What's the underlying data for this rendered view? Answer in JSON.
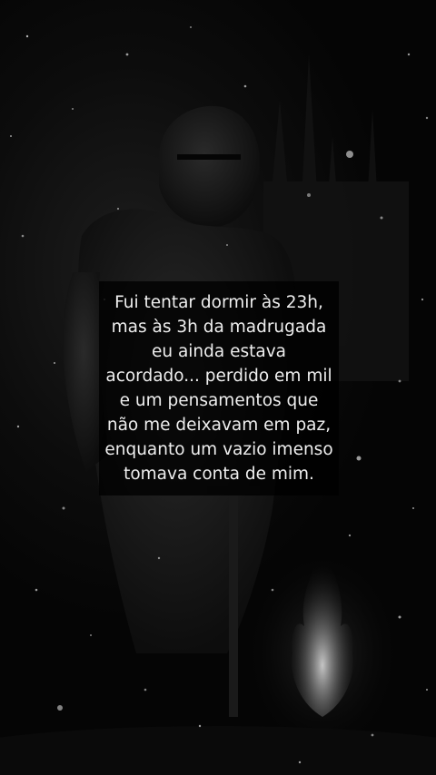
{
  "background": {
    "scene": "dark-knight-in-snow",
    "colors": {
      "base": "#060606",
      "figure": "#1e1e1e",
      "fire": "#cfcfcf",
      "snow": "#ffffff"
    }
  },
  "caption": {
    "text": "Fui tentar dormir às 23h,\nmas às 3h da madrugada\neu ainda estava\nacordado... perdido em mil\ne um pensamentos que\nnão me deixavam em paz,\nenquanto um vazio imenso\ntomava conta de mim."
  }
}
